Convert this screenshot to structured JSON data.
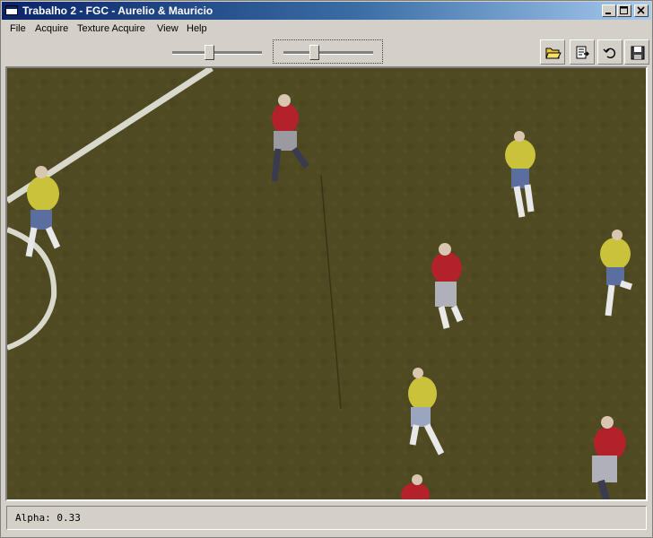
{
  "window": {
    "title": "Trabalho 2 - FGC - Aurelio & Mauricio",
    "controls": [
      "minimize-icon",
      "maximize-icon",
      "close-icon"
    ]
  },
  "menu": {
    "items": [
      {
        "label": "File"
      },
      {
        "label": "Acquire"
      },
      {
        "label": "Texture Acquire"
      },
      {
        "label": "View"
      },
      {
        "label": "Help"
      }
    ]
  },
  "toolbar": {
    "sliders": [
      {
        "name": "slider-1",
        "value": 0.4
      },
      {
        "name": "slider-2",
        "value": 0.33
      }
    ],
    "buttons": [
      {
        "icon": "open-folder-icon"
      },
      {
        "icon": "export-icon"
      },
      {
        "icon": "undo-icon"
      },
      {
        "icon": "save-icon"
      }
    ]
  },
  "viewport": {
    "content": "soccer-field-video-frame",
    "colors": {
      "grass": "#4f4a22",
      "team_a": "#c9c23a",
      "team_b": "#b3222a"
    }
  },
  "status": {
    "text": "Alpha: 0.33"
  }
}
